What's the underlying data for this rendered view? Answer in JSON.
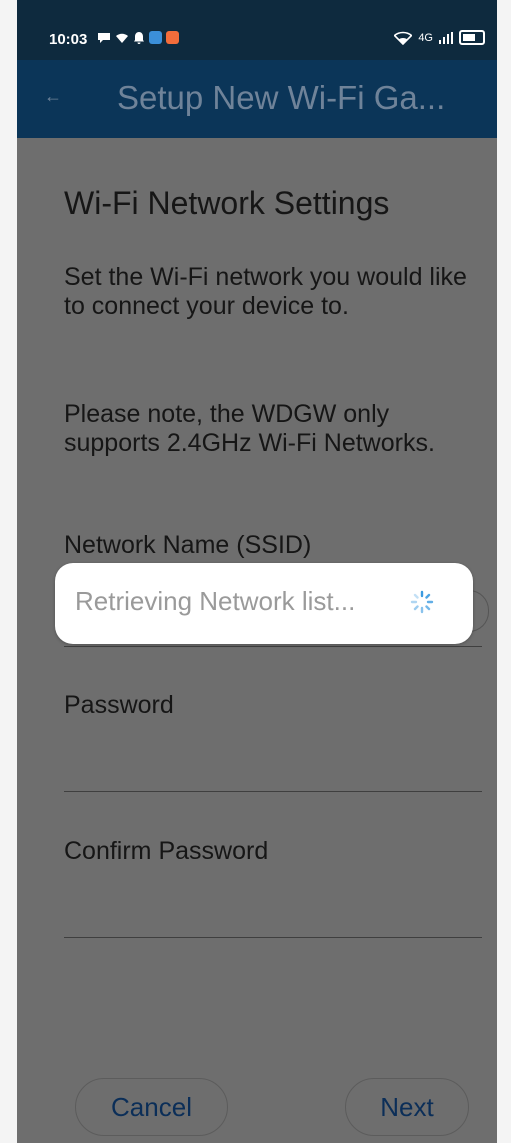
{
  "status_bar": {
    "time": "10:03",
    "network_label": "4G"
  },
  "app_bar": {
    "back_icon": "arrow-left-icon",
    "title": "Setup New Wi-Fi Ga..."
  },
  "screen": {
    "heading": "Wi-Fi Network Settings",
    "intro": "Set the Wi-Fi network you would like to connect your device to.",
    "note": "Please note, the WDGW only supports 2.4GHz Wi-Fi Networks.",
    "fields": {
      "ssid_label": "Network Name (SSID)",
      "password_label": "Password",
      "confirm_password_label": "Confirm Password"
    }
  },
  "toast": {
    "text": "Retrieving Network list...",
    "icon": "loading-spinner-icon"
  },
  "buttons": {
    "cancel": "Cancel",
    "next": "Next"
  },
  "colors": {
    "status_bar": "#0e2a3e",
    "app_bar": "#0b3558",
    "overlay_background": "#6e6e6e",
    "button_text": "#0b2e58"
  }
}
